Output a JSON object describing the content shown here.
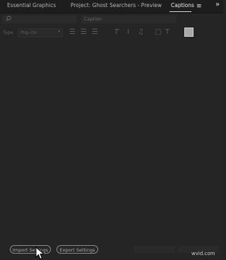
{
  "tabs": [
    {
      "label": "Essential Graphics",
      "active": false
    },
    {
      "label": "Project: Ghost Searchers - Preview",
      "active": false
    },
    {
      "label": "Captions",
      "active": true
    }
  ],
  "tab_menu_icon": "≡",
  "overflow_icon": "»",
  "toolbar": {
    "search_placeholder": "",
    "caption_placeholder": "Caption",
    "type_label": "Type",
    "type_value": "Pop-On",
    "type_caret": "▾",
    "tools": [
      {
        "name": "align-left-icon",
        "glyph": "☰"
      },
      {
        "name": "align-center-icon",
        "glyph": "☰"
      },
      {
        "name": "align-right-icon",
        "glyph": "☰"
      },
      {
        "name": "italic-icon",
        "glyph": "T"
      },
      {
        "name": "underline-icon",
        "glyph": "I"
      },
      {
        "name": "music-note-icon",
        "glyph": "♫"
      },
      {
        "name": "background-box-icon",
        "glyph": "□"
      },
      {
        "name": "text-color-icon",
        "glyph": "T"
      }
    ],
    "swatch_color": "#a9a9a9"
  },
  "footer": {
    "import_label": "Import Settings",
    "export_label": "Export Settings"
  },
  "watermark": "wvid.com",
  "colors": {
    "background": "#232323",
    "tab_bar": "#1d1d1d",
    "active_tab_underline": "#d8d8d8"
  }
}
